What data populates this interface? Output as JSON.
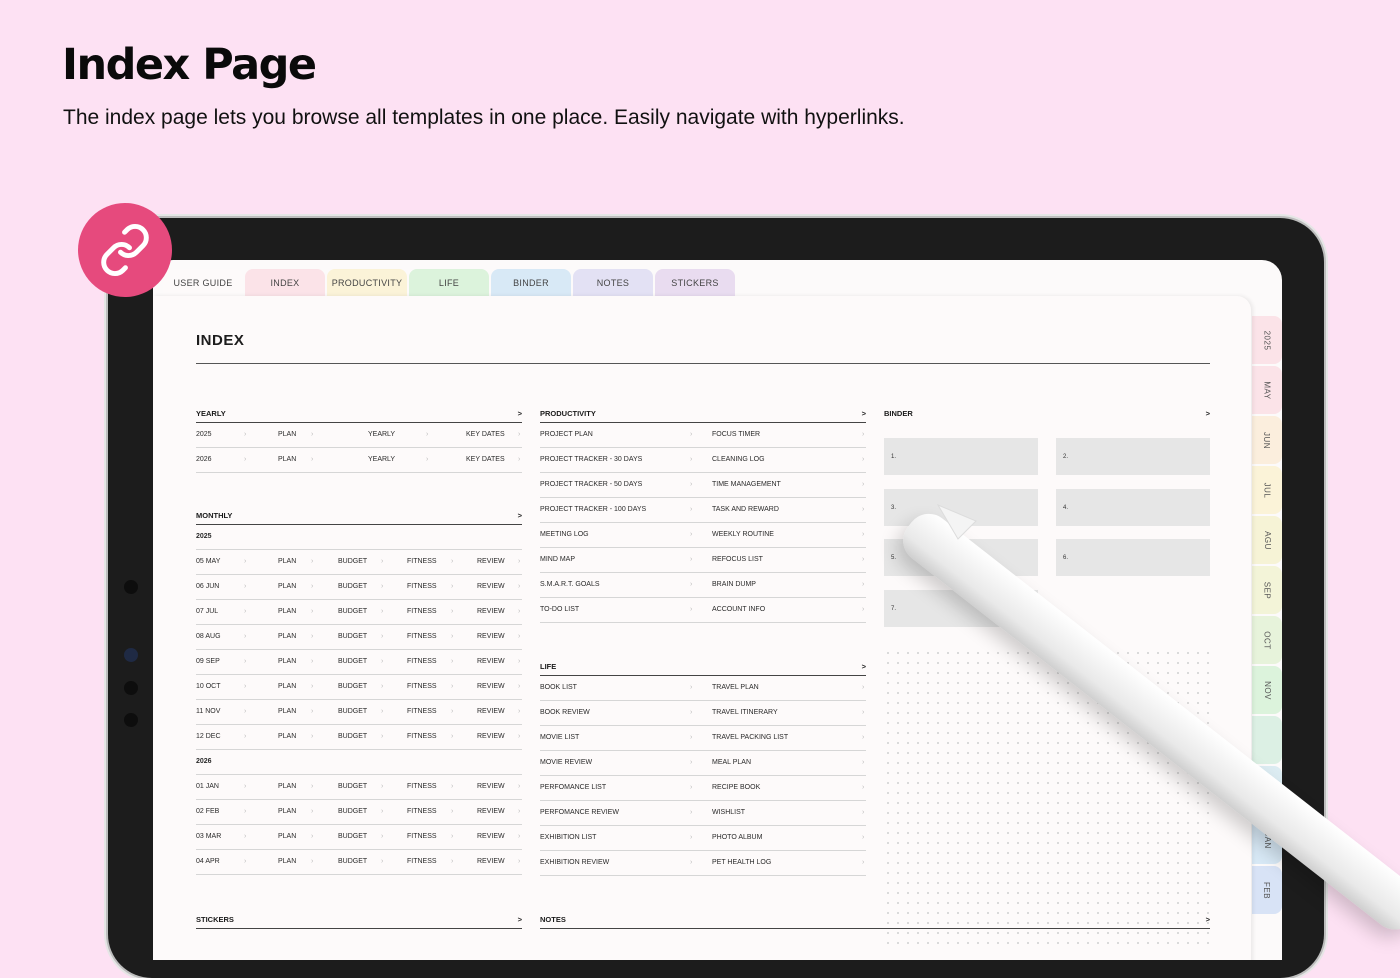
{
  "hero": {
    "title": "Index Page",
    "subtitle": "The index page lets you browse all templates in one place. Easily navigate with hyperlinks."
  },
  "icons": {
    "badge": "link-icon",
    "badge_color": "#e64a7d"
  },
  "top_tabs": [
    {
      "label": "USER GUIDE",
      "color": "#fdfafa"
    },
    {
      "label": "INDEX",
      "color": "#fbe3e8"
    },
    {
      "label": "PRODUCTIVITY",
      "color": "#fbf3d8"
    },
    {
      "label": "LIFE",
      "color": "#dcf3dc"
    },
    {
      "label": "BINDER",
      "color": "#d8e9f6"
    },
    {
      "label": "NOTES",
      "color": "#e3e1f4"
    },
    {
      "label": "STICKERS",
      "color": "#e9dcf0"
    }
  ],
  "side_tabs": [
    {
      "label": "2025",
      "color": "#fbe3e8"
    },
    {
      "label": "MAY",
      "color": "#fbe3e8"
    },
    {
      "label": "JUN",
      "color": "#fbeedd"
    },
    {
      "label": "JUL",
      "color": "#fbf3d8"
    },
    {
      "label": "AGU",
      "color": "#f6f3d6"
    },
    {
      "label": "SEP",
      "color": "#f3f4d8"
    },
    {
      "label": "OCT",
      "color": "#e7f3db"
    },
    {
      "label": "NOV",
      "color": "#dcf3dc"
    },
    {
      "label": "",
      "color": "#dcf0e4"
    },
    {
      "label": "2026",
      "color": "#dcecf2"
    },
    {
      "label": "JAN",
      "color": "#d8e9f6"
    },
    {
      "label": "FEB",
      "color": "#d8e3f6"
    }
  ],
  "index": {
    "title": "INDEX",
    "yearly": {
      "heading": "YEARLY",
      "arrow": ">",
      "rows": [
        [
          "2025",
          "PLAN",
          "YEARLY",
          "KEY DATES"
        ],
        [
          "2026",
          "PLAN",
          "YEARLY",
          "KEY DATES"
        ]
      ]
    },
    "monthly": {
      "heading": "MONTHLY",
      "arrow": ">",
      "year1": "2025",
      "rows1": [
        [
          "05 MAY",
          "PLAN",
          "BUDGET",
          "FITNESS",
          "REVIEW"
        ],
        [
          "06 JUN",
          "PLAN",
          "BUDGET",
          "FITNESS",
          "REVIEW"
        ],
        [
          "07 JUL",
          "PLAN",
          "BUDGET",
          "FITNESS",
          "REVIEW"
        ],
        [
          "08 AUG",
          "PLAN",
          "BUDGET",
          "FITNESS",
          "REVIEW"
        ],
        [
          "09 SEP",
          "PLAN",
          "BUDGET",
          "FITNESS",
          "REVIEW"
        ],
        [
          "10 OCT",
          "PLAN",
          "BUDGET",
          "FITNESS",
          "REVIEW"
        ],
        [
          "11 NOV",
          "PLAN",
          "BUDGET",
          "FITNESS",
          "REVIEW"
        ],
        [
          "12 DEC",
          "PLAN",
          "BUDGET",
          "FITNESS",
          "REVIEW"
        ]
      ],
      "year2": "2026",
      "rows2": [
        [
          "01 JAN",
          "PLAN",
          "BUDGET",
          "FITNESS",
          "REVIEW"
        ],
        [
          "02 FEB",
          "PLAN",
          "BUDGET",
          "FITNESS",
          "REVIEW"
        ],
        [
          "03 MAR",
          "PLAN",
          "BUDGET",
          "FITNESS",
          "REVIEW"
        ],
        [
          "04 APR",
          "PLAN",
          "BUDGET",
          "FITNESS",
          "REVIEW"
        ]
      ]
    },
    "productivity": {
      "heading": "PRODUCTIVITY",
      "arrow": ">",
      "rows": [
        [
          "PROJECT PLAN",
          "FOCUS TIMER"
        ],
        [
          "PROJECT TRACKER - 30 DAYS",
          "CLEANING LOG"
        ],
        [
          "PROJECT TRACKER - 50 DAYS",
          "TIME MANAGEMENT"
        ],
        [
          "PROJECT TRACKER - 100 DAYS",
          "TASK AND REWARD"
        ],
        [
          "MEETING LOG",
          "WEEKLY ROUTINE"
        ],
        [
          "MIND MAP",
          "REFOCUS LIST"
        ],
        [
          "S.M.A.R.T. GOALS",
          "BRAIN DUMP"
        ],
        [
          "TO-DO LIST",
          "ACCOUNT INFO"
        ]
      ]
    },
    "life": {
      "heading": "LIFE",
      "arrow": ">",
      "rows": [
        [
          "BOOK LIST",
          "TRAVEL PLAN"
        ],
        [
          "BOOK REVIEW",
          "TRAVEL ITINERARY"
        ],
        [
          "MOVIE LIST",
          "TRAVEL PACKING LIST"
        ],
        [
          "MOVIE REVIEW",
          "MEAL PLAN"
        ],
        [
          "PERFOMANCE LIST",
          "RECIPE BOOK"
        ],
        [
          "PERFOMANCE REVIEW",
          "WISHLIST"
        ],
        [
          "EXHIBITION LIST",
          "PHOTO ALBUM"
        ],
        [
          "EXHIBITION REVIEW",
          "PET HEALTH LOG"
        ]
      ]
    },
    "binder": {
      "heading": "BINDER",
      "arrow": ">",
      "cards": [
        "1.",
        "2.",
        "3.",
        "4.",
        "5.",
        "6.",
        "7."
      ]
    },
    "stickers": {
      "heading": "STICKERS",
      "arrow": ">"
    },
    "notes": {
      "heading": "NOTES",
      "arrow": ">"
    }
  }
}
